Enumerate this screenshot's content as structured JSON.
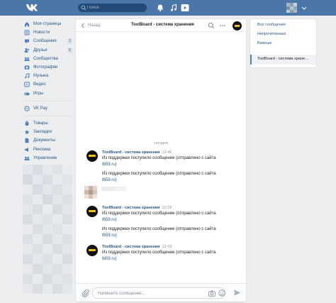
{
  "topbar": {
    "search_placeholder": "Поиск"
  },
  "sidebar": {
    "items": [
      {
        "label": "Моя страница",
        "icon": "home-icon"
      },
      {
        "label": "Новости",
        "icon": "news-icon"
      },
      {
        "label": "Сообщения",
        "icon": "messages-icon",
        "badge": "2"
      },
      {
        "label": "Друзья",
        "icon": "friends-icon",
        "badge": "5"
      },
      {
        "label": "Сообщества",
        "icon": "communities-icon"
      },
      {
        "label": "Фотографии",
        "icon": "photos-icon"
      },
      {
        "label": "Музыка",
        "icon": "music-icon"
      },
      {
        "label": "Видео",
        "icon": "video-icon"
      },
      {
        "label": "Игры",
        "icon": "games-icon"
      }
    ],
    "pay": {
      "label": "VK Pay",
      "icon": "vkpay-icon"
    },
    "extra": [
      {
        "label": "Товары",
        "icon": "goods-icon"
      },
      {
        "label": "Закладки",
        "icon": "bookmarks-icon"
      },
      {
        "label": "Документы",
        "icon": "documents-icon"
      },
      {
        "label": "Реклама",
        "icon": "ads-icon"
      },
      {
        "label": "Управление",
        "icon": "manage-icon"
      }
    ]
  },
  "chat": {
    "back_label": "Назад",
    "title": "ToolBoard - система хранения",
    "day_label": "сегодня",
    "messages": [
      {
        "name": "ToolBoard - система хранения",
        "time": "12:46",
        "lines": [
          "Из поддержки поступило сообщение (отправлено с сайта",
          "tb59.ru)"
        ],
        "extra": [
          "Из поддержки поступило сообщение (отправлено с сайта",
          "tb59.ru)"
        ]
      },
      {
        "name": "ToolBoard - система хранения",
        "time": "12:29",
        "lines": [
          "Из поддержки поступило сообщение (отправлено с сайта",
          "tb59.ru)"
        ],
        "extra": [
          "Из поддержки поступило сообщение (отправлено с сайта",
          "tb59.ru)"
        ]
      },
      {
        "name": "ToolBoard - система хранения",
        "time": "12:43",
        "lines": [
          "Из поддержки поступило сообщение (отправлено с сайта",
          "tb59.ru)"
        ],
        "extra": []
      }
    ],
    "composer_placeholder": "Напишите сообщение..."
  },
  "right_panel": {
    "filters": [
      "Все сообщения",
      "Непрочитанные",
      "Важные"
    ],
    "active_chat": "ToolBoard - система хране..."
  },
  "colors": {
    "header": "#4a76a8",
    "link": "#2a5885",
    "background": "#edeef0"
  }
}
